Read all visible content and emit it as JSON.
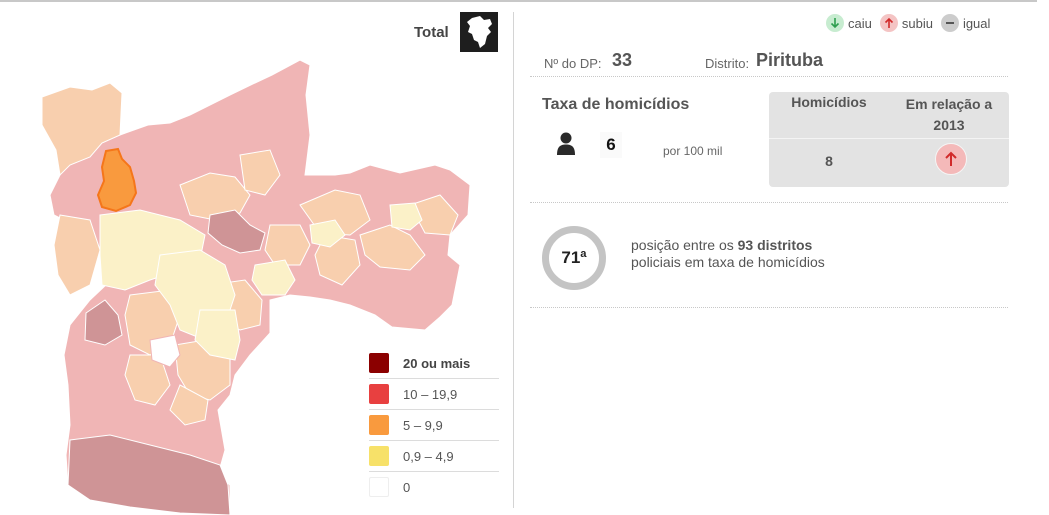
{
  "map": {
    "title": "Total",
    "colors": {
      "very_high": "#8b0000",
      "high": "#e84040",
      "mid": "#f99a3e",
      "low": "#f7e169",
      "zero": "#ffffff",
      "region_pink": "#f0b5b5",
      "region_peach": "#f8cfae",
      "region_cream": "#fbf1c8",
      "region_mauve": "#cf9496",
      "selected": "#f99a3e"
    },
    "selected_district": "Pirituba"
  },
  "legend": {
    "items": [
      {
        "label": "20 ou mais",
        "color": "#8b0000"
      },
      {
        "label": "10 – 19,9",
        "color": "#e84040"
      },
      {
        "label": "5 – 9,9",
        "color": "#f99a3e"
      },
      {
        "label": "0,9 – 4,9",
        "color": "#f7e169"
      },
      {
        "label": "0",
        "color": "#ffffff"
      }
    ]
  },
  "trend_legend": {
    "down": {
      "label": "caiu",
      "color": "#2e9e4f",
      "bg": "#c7ecd0",
      "icon": "arrow-down-icon"
    },
    "up": {
      "label": "subiu",
      "color": "#d12a2a",
      "bg": "#f4c4c4",
      "icon": "arrow-up-icon"
    },
    "equal": {
      "label": "igual",
      "color": "#555555",
      "bg": "#cccccc",
      "icon": "minus-icon"
    }
  },
  "district": {
    "dp_label": "Nº do DP:",
    "dp_number": "33",
    "district_label": "Distrito:",
    "district_name": "Pirituba"
  },
  "rate": {
    "title": "Taxa de homicídios",
    "value": "6",
    "unit": "por 100 mil"
  },
  "homicides": {
    "count_header": "Homicídios",
    "change_header": "Em relação a 2013",
    "count": "8",
    "change": "up"
  },
  "rank": {
    "position": "71ª",
    "text_prefix": "posição entre os ",
    "text_bold": "93 distritos",
    "text_line2": "policiais em taxa de homicídios"
  }
}
